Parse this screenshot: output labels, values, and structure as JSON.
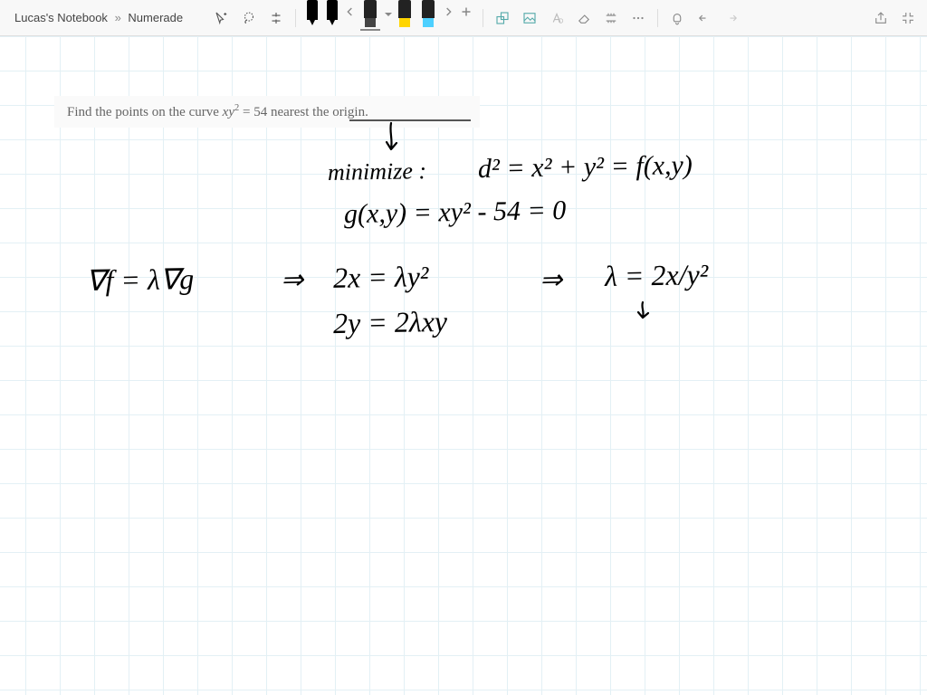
{
  "breadcrumb": {
    "notebook": "Lucas's Notebook",
    "separator": "»",
    "page": "Numerade"
  },
  "toolbar": {
    "icons": {
      "text_cursor": "text-cursor-icon",
      "lasso": "lasso-icon",
      "panel_split": "panel-split-icon",
      "prev": "prev-icon",
      "next": "next-icon",
      "add_page": "add-page-icon",
      "shapes": "shapes-icon",
      "clipboard": "clipboard-icon",
      "link": "link-icon",
      "eraser": "eraser-icon",
      "ruler": "ruler-icon",
      "more": "more-icon",
      "notification": "notification-icon",
      "undo": "undo-icon",
      "redo": "redo-icon",
      "share": "share-icon",
      "fullscreen_exit": "fullscreen-exit-icon"
    },
    "pens": [
      {
        "color": "#000000",
        "type": "pen"
      },
      {
        "color": "#000000",
        "type": "pen"
      },
      {
        "color": "#1a1a1a",
        "type": "highlighter",
        "tip": "#333",
        "selected": true
      },
      {
        "color": "#ffd500",
        "type": "highlighter",
        "tip": "#ffd500"
      },
      {
        "color": "#4dd0ff",
        "type": "highlighter",
        "tip": "#4dd0ff"
      }
    ]
  },
  "problem": {
    "prefix": "Find the points on the curve ",
    "equation_lhs": "xy",
    "equation_exp": "2",
    "equation_eq": " = 54",
    "suffix": " nearest the origin."
  },
  "handwriting": {
    "line1a": "minimize :",
    "line1b": "d² = x² + y² = f(x,y)",
    "line2": "g(x,y) = xy² - 54 = 0",
    "line3a": "∇f = λ∇g",
    "line3b": "⇒",
    "line3c": "2x = λy²",
    "line3d": "⇒",
    "line3e": "λ = 2x/y²",
    "line4": "2y = 2λxy"
  }
}
